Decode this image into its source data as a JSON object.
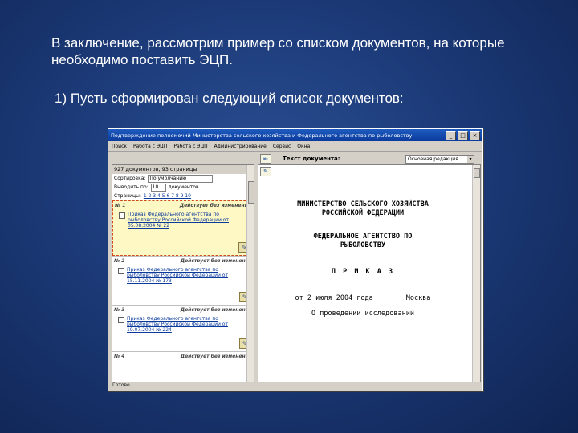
{
  "slide": {
    "title": "В заключение, рассмотрим пример со списком документов, на которые необходимо поставить ЭЦП.",
    "step": "1)  Пусть сформирован следующий список документов:"
  },
  "window": {
    "title": "Подтверждение полномочий Министерства сельского хозяйства и Федерального агентства по рыболовству",
    "menu": [
      "Поиск",
      "Работа с ЭЦП",
      "Работа с ЭЦП",
      "Администрирование",
      "Сервис",
      "Окна"
    ],
    "left": {
      "header": "927 документов, 93 страницы",
      "sort_label": "Сортировка:",
      "sort_value": "По умолчанию",
      "page_label": "Выводить по:",
      "page_value": "10",
      "page_suffix": "документов",
      "pages_label": "Страницы:",
      "pages": "1 2 3 4 5 6 7 8 9 10",
      "docs": [
        {
          "num": "№ 1",
          "status": "Действует без изменений",
          "text": "Приказ Федерального агентства по рыболовству Российской Федерации от 05.08.2004 № 22"
        },
        {
          "num": "№ 2",
          "status": "Действует без изменений",
          "text": "Приказ Федерального агентства по рыболовству Российской Федерации от 15.11.2004 № 173"
        },
        {
          "num": "№ 3",
          "status": "Действует без изменений",
          "text": "Приказ Федерального агентства по рыболовству Российской Федерации от 19.07.2004 № 224"
        },
        {
          "num": "№ 4",
          "status": "Действует без изменений",
          "text": ""
        }
      ]
    },
    "right": {
      "label": "Текст документа:",
      "dropdown": "Основная редакция",
      "doc_lines": [
        "МИНИСТЕРСТВО СЕЛЬСКОГО ХОЗЯЙСТВА",
        "РОССИЙСКОЙ ФЕДЕРАЦИИ",
        "",
        "ФЕДЕРАЛЬНОЕ АГЕНТСТВО ПО",
        "РЫБОЛОВСТВУ",
        "",
        "П Р И К А З",
        "",
        "от 2 июля 2004 года        Москва",
        "О проведении исследований"
      ]
    },
    "status": "Готово"
  }
}
